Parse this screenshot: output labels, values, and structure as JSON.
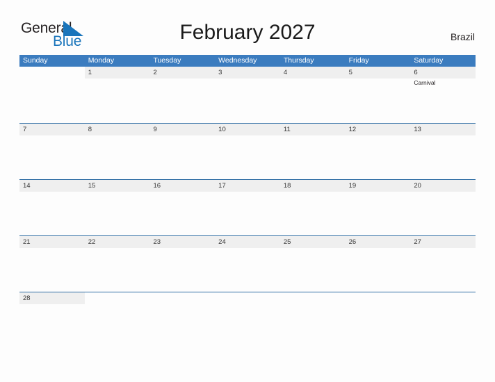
{
  "brand": {
    "word_one": "General",
    "word_two": "Blue",
    "triangle_icon": "blue-triangle-icon",
    "color_dark": "#231f20",
    "color_blue": "#1a75bb"
  },
  "header": {
    "title": "February 2027",
    "region": "Brazil"
  },
  "theme": {
    "header_blue": "#3b7cbf",
    "row_divider_blue": "#2e6da4",
    "day_stripe_gray": "#efefef",
    "page_background": "#fdfdfd"
  },
  "calendar": {
    "weekdays": [
      "Sunday",
      "Monday",
      "Tuesday",
      "Wednesday",
      "Thursday",
      "Friday",
      "Saturday"
    ],
    "weeks": [
      {
        "days": [
          {
            "number": "",
            "events": []
          },
          {
            "number": "1",
            "events": []
          },
          {
            "number": "2",
            "events": []
          },
          {
            "number": "3",
            "events": []
          },
          {
            "number": "4",
            "events": []
          },
          {
            "number": "5",
            "events": []
          },
          {
            "number": "6",
            "events": [
              "Carnival"
            ]
          }
        ]
      },
      {
        "days": [
          {
            "number": "7",
            "events": []
          },
          {
            "number": "8",
            "events": []
          },
          {
            "number": "9",
            "events": []
          },
          {
            "number": "10",
            "events": []
          },
          {
            "number": "11",
            "events": []
          },
          {
            "number": "12",
            "events": []
          },
          {
            "number": "13",
            "events": []
          }
        ]
      },
      {
        "days": [
          {
            "number": "14",
            "events": []
          },
          {
            "number": "15",
            "events": []
          },
          {
            "number": "16",
            "events": []
          },
          {
            "number": "17",
            "events": []
          },
          {
            "number": "18",
            "events": []
          },
          {
            "number": "19",
            "events": []
          },
          {
            "number": "20",
            "events": []
          }
        ]
      },
      {
        "days": [
          {
            "number": "21",
            "events": []
          },
          {
            "number": "22",
            "events": []
          },
          {
            "number": "23",
            "events": []
          },
          {
            "number": "24",
            "events": []
          },
          {
            "number": "25",
            "events": []
          },
          {
            "number": "26",
            "events": []
          },
          {
            "number": "27",
            "events": []
          }
        ]
      },
      {
        "days": [
          {
            "number": "28",
            "events": []
          },
          {
            "number": "",
            "events": []
          },
          {
            "number": "",
            "events": []
          },
          {
            "number": "",
            "events": []
          },
          {
            "number": "",
            "events": []
          },
          {
            "number": "",
            "events": []
          },
          {
            "number": "",
            "events": []
          }
        ]
      }
    ]
  }
}
